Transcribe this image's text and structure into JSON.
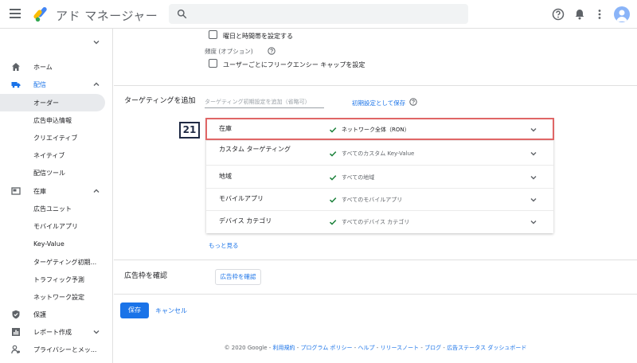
{
  "header": {
    "app_title": "アド マネージャー"
  },
  "sidebar": {
    "items": [
      {
        "label": "ホーム"
      },
      {
        "label": "配信"
      },
      {
        "label": "オーダー"
      },
      {
        "label": "広告申込情報"
      },
      {
        "label": "クリエイティブ"
      },
      {
        "label": "ネイティブ"
      },
      {
        "label": "配信ツール"
      },
      {
        "label": "在庫"
      },
      {
        "label": "広告ユニット"
      },
      {
        "label": "モバイルアプリ"
      },
      {
        "label": "Key-Value"
      },
      {
        "label": "ターゲティング初期..."
      },
      {
        "label": "トラフィック予測"
      },
      {
        "label": "ネットワーク設定"
      },
      {
        "label": "保護"
      },
      {
        "label": "レポート作成"
      },
      {
        "label": "プライバシーとメッ..."
      }
    ]
  },
  "schedule": {
    "checkbox_label": "曜日と時間帯を設定する"
  },
  "frequency": {
    "title": "頻度 (オプション)",
    "checkbox_label": "ユーザーごとにフリークエンシー キャップを設定"
  },
  "targeting": {
    "section_title": "ターゲティングを追加",
    "input_placeholder": "ターゲティング初期設定を追加（省略可）",
    "save_default_label": "初期設定として保存",
    "step_number": "21",
    "rows": [
      {
        "name": "在庫",
        "value": "ネットワーク全体（RON）"
      },
      {
        "name": "カスタム ターゲティング",
        "value": "すべてのカスタム Key-Value"
      },
      {
        "name": "地域",
        "value": "すべての地域"
      },
      {
        "name": "モバイルアプリ",
        "value": "すべてのモバイルアプリ"
      },
      {
        "name": "デバイス カテゴリ",
        "value": "すべてのデバイス カテゴリ"
      }
    ],
    "show_more_label": "もっと見る"
  },
  "inventory_check": {
    "title": "広告枠を確認",
    "button_label": "広告枠を確認"
  },
  "actions": {
    "save_label": "保存",
    "cancel_label": "キャンセル"
  },
  "footer": {
    "copyright": "© 2020 Google",
    "links": [
      "利用規約",
      "プログラム ポリシー",
      "ヘルプ",
      "リリースノート",
      "ブログ",
      "広告ステータス ダッシュボード"
    ]
  },
  "colors": {
    "accent": "#1a73e8",
    "highlight": "#e06666",
    "check": "#188038"
  }
}
